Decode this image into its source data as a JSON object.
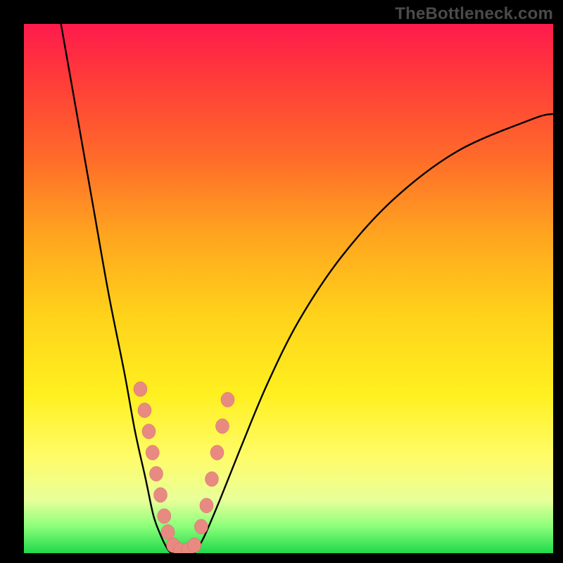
{
  "watermark": "TheBottleneck.com",
  "colors": {
    "background": "#000000",
    "curve_stroke": "#000000",
    "marker_fill": "#e98a82",
    "marker_stroke": "#d06a62"
  },
  "chart_data": {
    "type": "line",
    "title": "",
    "xlabel": "",
    "ylabel": "",
    "xlim": [
      0,
      100
    ],
    "ylim": [
      0,
      100
    ],
    "series": [
      {
        "name": "left-curve",
        "x": [
          7,
          10,
          13,
          16,
          19,
          21,
          23,
          24.5,
          26,
          27,
          27.8
        ],
        "y": [
          100,
          83,
          66,
          49,
          34,
          23,
          14,
          7,
          3,
          1,
          0
        ]
      },
      {
        "name": "floor",
        "x": [
          27.8,
          32.2
        ],
        "y": [
          0,
          0
        ]
      },
      {
        "name": "right-curve",
        "x": [
          32.2,
          34,
          37,
          41,
          46,
          52,
          60,
          70,
          82,
          96,
          100
        ],
        "y": [
          0,
          3,
          10,
          20,
          32,
          44,
          56,
          67,
          76,
          82,
          83
        ]
      }
    ],
    "markers": {
      "name": "data-points",
      "points": [
        {
          "x": 22.0,
          "y": 31
        },
        {
          "x": 22.8,
          "y": 27
        },
        {
          "x": 23.6,
          "y": 23
        },
        {
          "x": 24.3,
          "y": 19
        },
        {
          "x": 25.0,
          "y": 15
        },
        {
          "x": 25.8,
          "y": 11
        },
        {
          "x": 26.5,
          "y": 7
        },
        {
          "x": 27.2,
          "y": 4
        },
        {
          "x": 28.2,
          "y": 1.5
        },
        {
          "x": 29.5,
          "y": 0.6
        },
        {
          "x": 31.0,
          "y": 0.6
        },
        {
          "x": 32.2,
          "y": 1.5
        },
        {
          "x": 33.5,
          "y": 5
        },
        {
          "x": 34.5,
          "y": 9
        },
        {
          "x": 35.5,
          "y": 14
        },
        {
          "x": 36.5,
          "y": 19
        },
        {
          "x": 37.5,
          "y": 24
        },
        {
          "x": 38.5,
          "y": 29
        }
      ]
    }
  }
}
